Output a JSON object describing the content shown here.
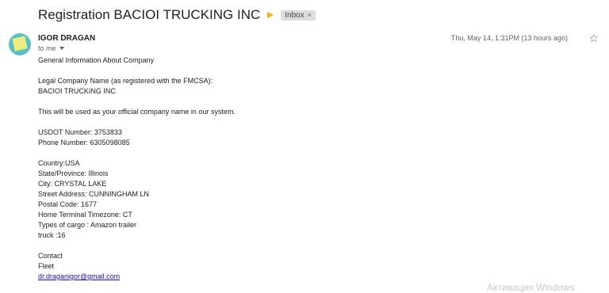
{
  "email": {
    "subject": "Registration BACIOI TRUCKING INC",
    "label": "Inbox",
    "label_close": "×",
    "sender": "IGOR DRAGAN",
    "recipient": "to me",
    "date": "Thu, May 14, 1:31PM (13 hours ago)",
    "star_icon": "☆",
    "body": {
      "l1": "General Information About Company",
      "l2": "Legal Company Name (as registered with the FMCSA):",
      "l3": "BACIOI TRUCKING INC",
      "l4": "This will be used as your official company name in our system.",
      "l5": "USDOT Number: 3753833",
      "l6": "Phone Number:  6305098085",
      "l7": "Country:USA",
      "l8": "State/Province: Illinois",
      "l9": "City: CRYSTAL LAKE",
      "l10": "Street Address: CUNNINGHAM LN",
      "l11": "Postal Code: 1677",
      "l12": "Home Terminal Timezone: CT",
      "l13": "Types of cargo : Amazon trailer",
      "l14": "truck :16",
      "l15": "Contact",
      "l16": "Fleet",
      "l17": "dr.draganigor@gmail.com"
    }
  },
  "watermark": "Активация Windows",
  "colors": {
    "importance": "#f4b400",
    "avatar_bg": "#5bc0c6",
    "link": "#1a0dab"
  }
}
